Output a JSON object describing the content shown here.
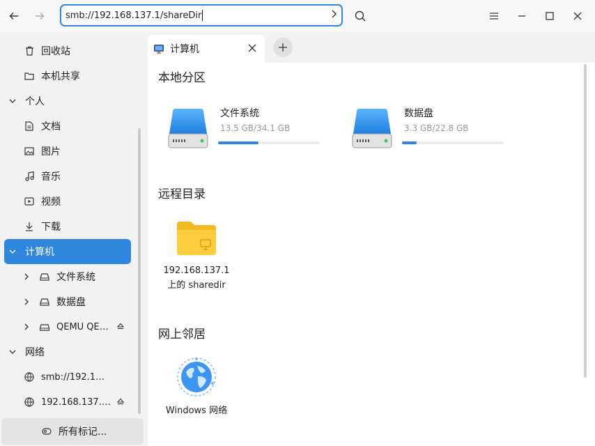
{
  "toolbar": {
    "address": "smb://192.168.137.1/shareDir"
  },
  "sidebar": {
    "items": [
      {
        "label": "回收站",
        "icon": "trash-icon"
      },
      {
        "label": "本机共享",
        "icon": "folder-icon"
      },
      {
        "label": "个人",
        "icon": "chevron-down-icon"
      },
      {
        "label": "文档",
        "icon": "document-icon"
      },
      {
        "label": "图片",
        "icon": "image-icon"
      },
      {
        "label": "音乐",
        "icon": "music-icon"
      },
      {
        "label": "视频",
        "icon": "video-icon"
      },
      {
        "label": "下载",
        "icon": "download-icon"
      },
      {
        "label": "计算机",
        "icon": "chevron-down-icon"
      },
      {
        "label": "文件系统",
        "icon": "disk-icon"
      },
      {
        "label": "数据盘",
        "icon": "disk-icon"
      },
      {
        "label": "QEMU QE…",
        "icon": "optical-drive-icon"
      },
      {
        "label": "网络",
        "icon": "chevron-down-icon"
      },
      {
        "label": "smb://192.1…",
        "icon": "network-globe-icon"
      },
      {
        "label": "192.168.137.…",
        "icon": "network-globe-icon"
      }
    ],
    "tags_label": "所有标记..."
  },
  "tabs": [
    {
      "label": "计算机",
      "icon": "computer-icon"
    }
  ],
  "main": {
    "local_section": "本地分区",
    "disks": [
      {
        "name": "文件系统",
        "size": "13.5 GB/34.1 GB",
        "used_fraction": 0.396
      },
      {
        "name": "数据盘",
        "size": "3.3 GB/22.8 GB",
        "used_fraction": 0.145
      }
    ],
    "remote_section": "远程目录",
    "remote_items": [
      {
        "line1": "192.168.137.1",
        "line2": "上的 sharedir"
      }
    ],
    "network_section": "网上邻居",
    "network_items": [
      {
        "label": "Windows 网络"
      }
    ]
  },
  "colors": {
    "accent": "#2e86de",
    "folder": "#f6c531"
  }
}
